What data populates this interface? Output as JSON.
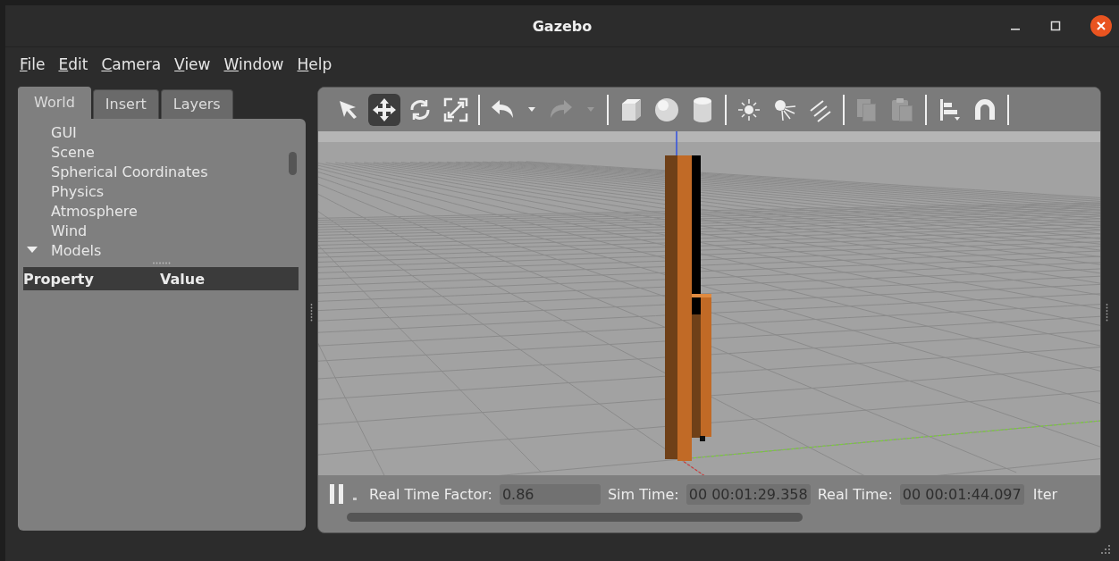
{
  "window": {
    "title": "Gazebo"
  },
  "menu": [
    "File",
    "Edit",
    "Camera",
    "View",
    "Window",
    "Help"
  ],
  "tabs": [
    {
      "label": "World",
      "selected": true
    },
    {
      "label": "Insert",
      "selected": false
    },
    {
      "label": "Layers",
      "selected": false
    }
  ],
  "tree": [
    {
      "label": "GUI",
      "expanded": false
    },
    {
      "label": "Scene",
      "expanded": false
    },
    {
      "label": "Spherical Coordinates",
      "expanded": false
    },
    {
      "label": "Physics",
      "expanded": false
    },
    {
      "label": "Atmosphere",
      "expanded": false
    },
    {
      "label": "Wind",
      "expanded": false
    },
    {
      "label": "Models",
      "expanded": true
    }
  ],
  "properties": {
    "columns": [
      "Property",
      "Value"
    ]
  },
  "toolbar": {
    "modes": [
      {
        "kind": "select",
        "selected": false
      },
      {
        "kind": "translate",
        "selected": true
      },
      {
        "kind": "rotate",
        "selected": false
      },
      {
        "kind": "scale",
        "selected": false
      }
    ],
    "history": [
      {
        "kind": "undo",
        "disabled": false
      },
      {
        "kind": "redo",
        "disabled": true
      }
    ],
    "shapes": [
      {
        "kind": "box"
      },
      {
        "kind": "sphere"
      },
      {
        "kind": "cylinder"
      }
    ],
    "lights": [
      {
        "kind": "point-light"
      },
      {
        "kind": "spot-light"
      },
      {
        "kind": "directional-light"
      }
    ],
    "clipboard": [
      {
        "kind": "copy",
        "disabled": true
      },
      {
        "kind": "paste",
        "disabled": true
      }
    ],
    "tools": [
      {
        "kind": "align"
      },
      {
        "kind": "snap"
      }
    ]
  },
  "status": {
    "paused": false,
    "fields": [
      {
        "label": "Real Time Factor:",
        "value": "0.86"
      },
      {
        "label": "Sim Time:",
        "value": "00 00:01:29.358"
      },
      {
        "label": "Real Time:",
        "value": "00 00:01:44.097"
      }
    ],
    "trailing": "Iter"
  }
}
